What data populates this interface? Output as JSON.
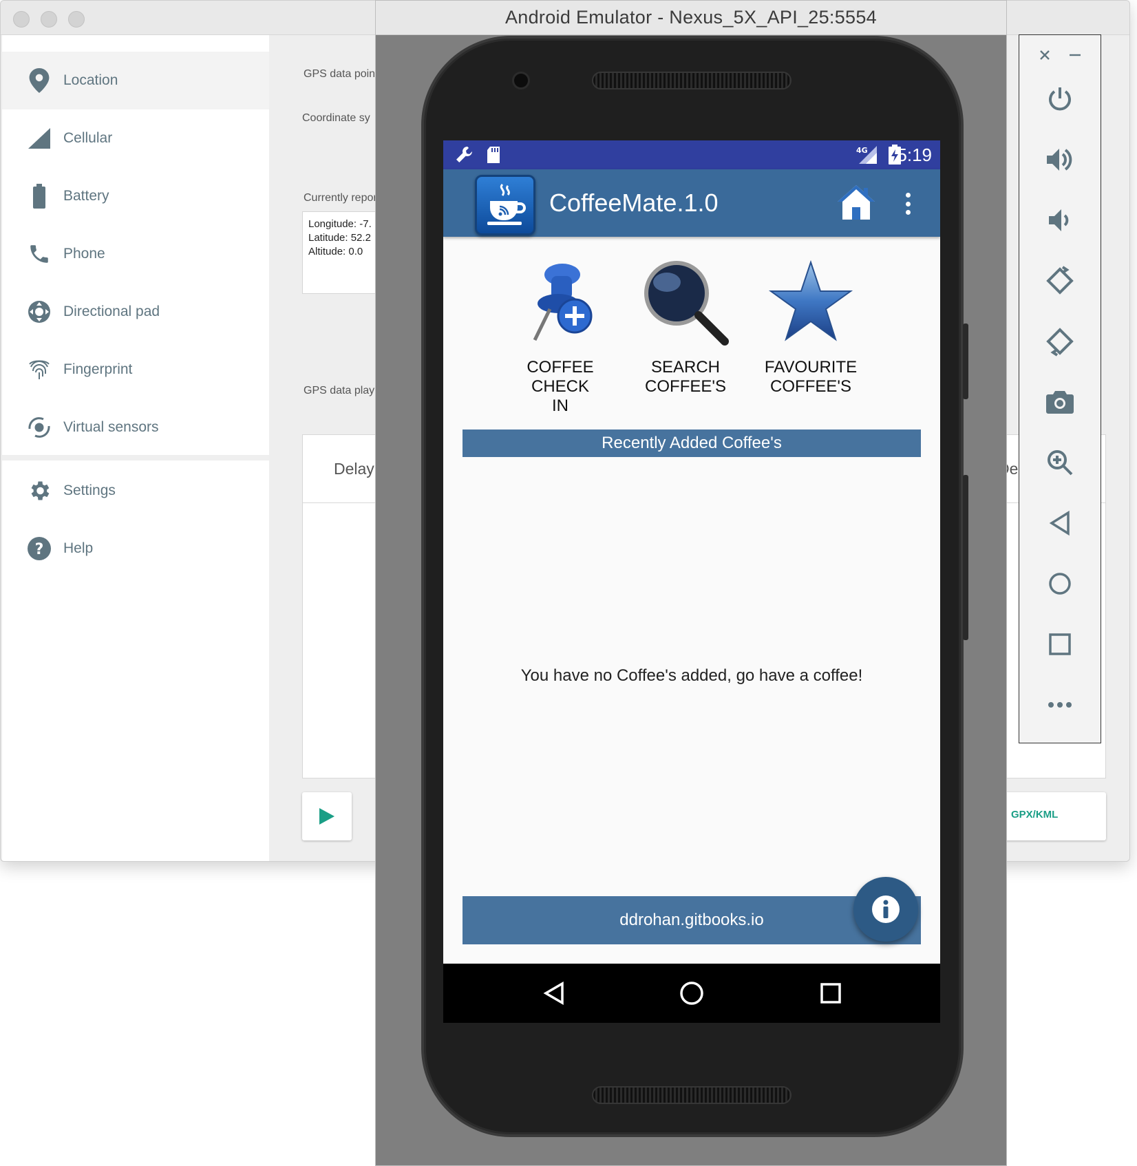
{
  "extended_controls": {
    "sidebar": {
      "items": [
        {
          "label": "Location",
          "icon": "location-pin-icon"
        },
        {
          "label": "Cellular",
          "icon": "cellular-signal-icon"
        },
        {
          "label": "Battery",
          "icon": "battery-icon"
        },
        {
          "label": "Phone",
          "icon": "phone-icon"
        },
        {
          "label": "Directional pad",
          "icon": "dpad-icon"
        },
        {
          "label": "Fingerprint",
          "icon": "fingerprint-icon"
        },
        {
          "label": "Virtual sensors",
          "icon": "virtual-sensors-icon"
        },
        {
          "label": "Settings",
          "icon": "gear-icon"
        },
        {
          "label": "Help",
          "icon": "help-icon"
        }
      ]
    },
    "location": {
      "gps_data_point_label": "GPS data point",
      "coordinate_system_label": "Coordinate sy",
      "currently_reported_label": "Currently repor",
      "coords": {
        "longitude": "Longitude: -7.",
        "latitude": "Latitude: 52.2",
        "altitude": "Altitude: 0.0"
      },
      "gps_playback_label": "GPS data playb",
      "table_delay_header": "Delay",
      "table_de_header": "De",
      "load_button_label": "GPX/KML"
    }
  },
  "emulator": {
    "window_title": "Android Emulator - Nexus_5X_API_25:5554",
    "toolbar": [
      "close-icon",
      "minimize-icon",
      "power-icon",
      "volume-up-icon",
      "volume-down-icon",
      "rotate-left-icon",
      "rotate-right-icon",
      "camera-icon",
      "zoom-icon",
      "back-icon",
      "home-icon",
      "overview-icon",
      "more-icon"
    ]
  },
  "device": {
    "status_bar": {
      "time": "5:19",
      "network": "4G"
    },
    "app_bar": {
      "title": "CoffeeMate.1.0"
    },
    "tiles": [
      {
        "label_line1": "COFFEE CHECK",
        "label_line2": "IN",
        "icon": "pushpin-add-icon"
      },
      {
        "label_line1": "SEARCH",
        "label_line2": "COFFEE'S",
        "icon": "magnifier-icon"
      },
      {
        "label_line1": "FAVOURITE",
        "label_line2": "COFFEE'S",
        "icon": "star-icon"
      }
    ],
    "recent_header": "Recently Added Coffee's",
    "empty_message": "You have no Coffee's added, go have a coffee!",
    "footer_link": "ddrohan.gitbooks.io",
    "colors": {
      "status_bar": "#303f9f",
      "app_bar": "#3a6a9a",
      "section_bar": "#47739e",
      "fab": "#2d5a85",
      "accent_green": "#1a9e86"
    }
  }
}
